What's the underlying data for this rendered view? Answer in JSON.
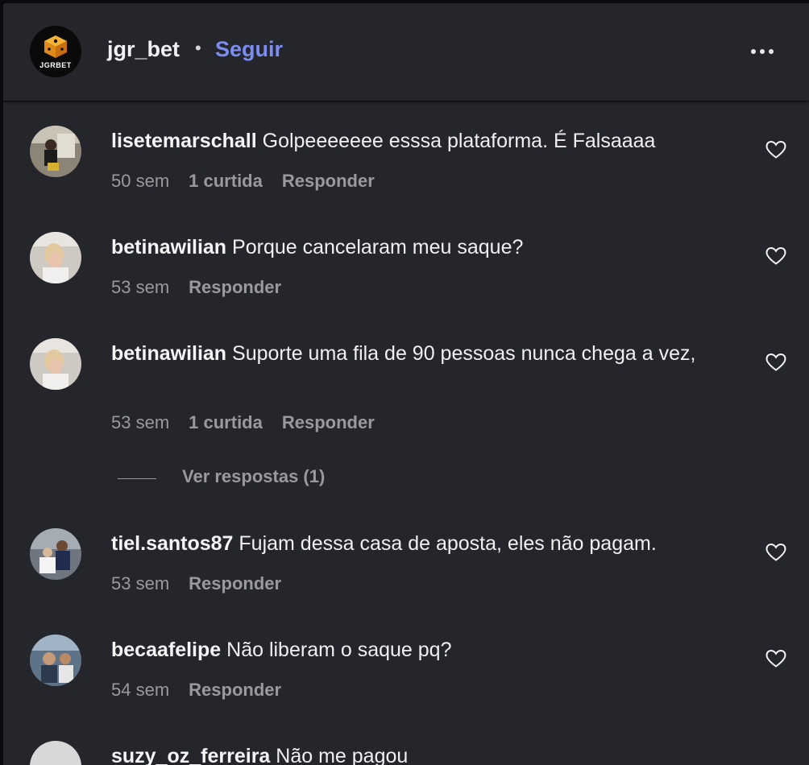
{
  "header": {
    "logo_text": "JGRBET",
    "username": "jgr_bet",
    "separator": "•",
    "follow_label": "Seguir",
    "more_icon": "more-horizontal-icon"
  },
  "comments": [
    {
      "username": "lisetemarschall",
      "text": "Golpeeeeeee esssa plataforma. É Falsaaaa",
      "time": "50 sem",
      "likes": "1 curtida",
      "reply_label": "Responder"
    },
    {
      "username": "betinawilian",
      "text": "Porque cancelaram meu saque?",
      "time": "53 sem",
      "reply_label": "Responder"
    },
    {
      "username": "betinawilian",
      "text": "Suporte uma fila de 90 pessoas nunca chega a vez,",
      "time": "53 sem",
      "likes": "1 curtida",
      "reply_label": "Responder",
      "view_replies": "Ver respostas (1)"
    },
    {
      "username": "tiel.santos87",
      "text": "Fujam dessa casa de aposta, eles não pagam.",
      "time": "53 sem",
      "reply_label": "Responder"
    },
    {
      "username": "becaafelipe",
      "text": "Não liberam o saque pq?",
      "time": "54 sem",
      "reply_label": "Responder"
    },
    {
      "username": "suzy_oz_ferreira",
      "text": "Não me pagou"
    }
  ],
  "icons": {
    "like": "heart-icon"
  },
  "colors": {
    "background": "#25262b",
    "follow_accent": "#7b8cf2",
    "secondary_text": "#9a9a9e",
    "primary_text": "#f0f0f0"
  }
}
